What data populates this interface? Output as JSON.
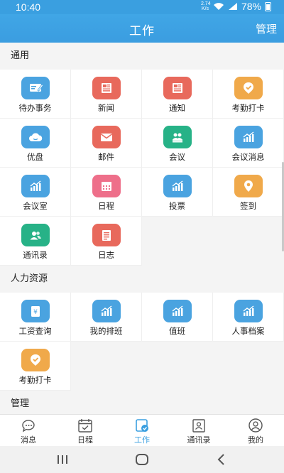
{
  "status_bar": {
    "time": "10:40",
    "net_speed": "2.74\nK/s",
    "battery": "78%"
  },
  "header": {
    "title": "工作",
    "manage": "管理"
  },
  "colors": {
    "accent": "#3a9fe0",
    "blue_icon": "#4aa3e0",
    "red_icon": "#e8695c",
    "orange_icon": "#f0a94a",
    "green_icon": "#27b287",
    "pink_icon": "#ee6f8a"
  },
  "sections": [
    {
      "title": "通用",
      "items": [
        {
          "label": "待办事务",
          "icon": "todo-icon",
          "color": "#4aa3e0"
        },
        {
          "label": "新闻",
          "icon": "newspaper-icon",
          "color": "#e8695c"
        },
        {
          "label": "通知",
          "icon": "notice-icon",
          "color": "#e8695c"
        },
        {
          "label": "考勤打卡",
          "icon": "check-in-icon",
          "color": "#f0a94a"
        },
        {
          "label": "优盘",
          "icon": "cloud-icon",
          "color": "#4aa3e0"
        },
        {
          "label": "邮件",
          "icon": "mail-icon",
          "color": "#e8695c"
        },
        {
          "label": "会议",
          "icon": "meeting-icon",
          "color": "#27b287"
        },
        {
          "label": "会议消息",
          "icon": "chart-icon",
          "color": "#4aa3e0"
        },
        {
          "label": "会议室",
          "icon": "chart-icon",
          "color": "#4aa3e0"
        },
        {
          "label": "日程",
          "icon": "calendar-icon",
          "color": "#ee6f8a"
        },
        {
          "label": "投票",
          "icon": "chart-icon",
          "color": "#4aa3e0"
        },
        {
          "label": "签到",
          "icon": "location-icon",
          "color": "#f0a94a"
        },
        {
          "label": "通讯录",
          "icon": "contacts-icon",
          "color": "#27b287"
        },
        {
          "label": "日志",
          "icon": "log-icon",
          "color": "#e8695c"
        }
      ]
    },
    {
      "title": "人力资源",
      "items": [
        {
          "label": "工资查询",
          "icon": "salary-icon",
          "color": "#4aa3e0"
        },
        {
          "label": "我的排班",
          "icon": "chart-icon",
          "color": "#4aa3e0"
        },
        {
          "label": "值班",
          "icon": "chart-icon",
          "color": "#4aa3e0"
        },
        {
          "label": "人事档案",
          "icon": "chart-icon",
          "color": "#4aa3e0"
        },
        {
          "label": "考勤打卡",
          "icon": "check-in-icon",
          "color": "#f0a94a"
        }
      ]
    },
    {
      "title": "管理",
      "items": []
    }
  ],
  "bottom_nav": [
    {
      "label": "消息",
      "icon": "message-icon",
      "active": false
    },
    {
      "label": "日程",
      "icon": "calendar-icon",
      "active": false
    },
    {
      "label": "工作",
      "icon": "work-icon",
      "active": true
    },
    {
      "label": "通讯录",
      "icon": "contacts-book-icon",
      "active": false
    },
    {
      "label": "我的",
      "icon": "profile-icon",
      "active": false
    }
  ]
}
